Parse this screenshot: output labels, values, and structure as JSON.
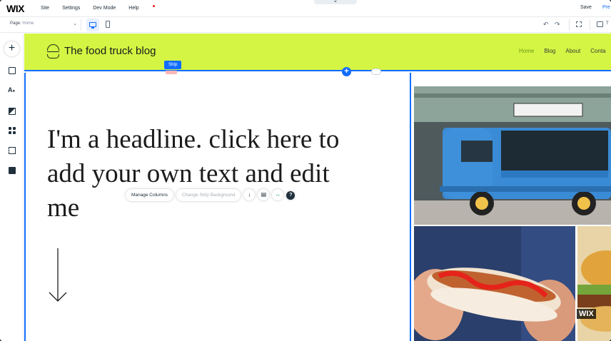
{
  "topbar": {
    "logo": "WIX",
    "menu": [
      "Site",
      "Settings",
      "Dev Mode",
      "Help"
    ],
    "save_label": "Save",
    "preview_label": "Pre"
  },
  "toolbar2": {
    "page_prefix": "Page:",
    "page_value": "Home",
    "panel_label": "T"
  },
  "site": {
    "title": "The food truck blog",
    "nav": [
      "Home",
      "Blog",
      "About",
      "Conta"
    ]
  },
  "editor": {
    "strip_label": "Strip",
    "headline": "I'm a headline. click here to add your own text and edit me",
    "manage_columns": "Manage Columns",
    "change_strip_bg": "Change Strip Background"
  },
  "watermark": "WIX",
  "colors": {
    "accent": "#116dff",
    "header_bg": "#d4f543",
    "nav_active": "#6f9a1a"
  }
}
